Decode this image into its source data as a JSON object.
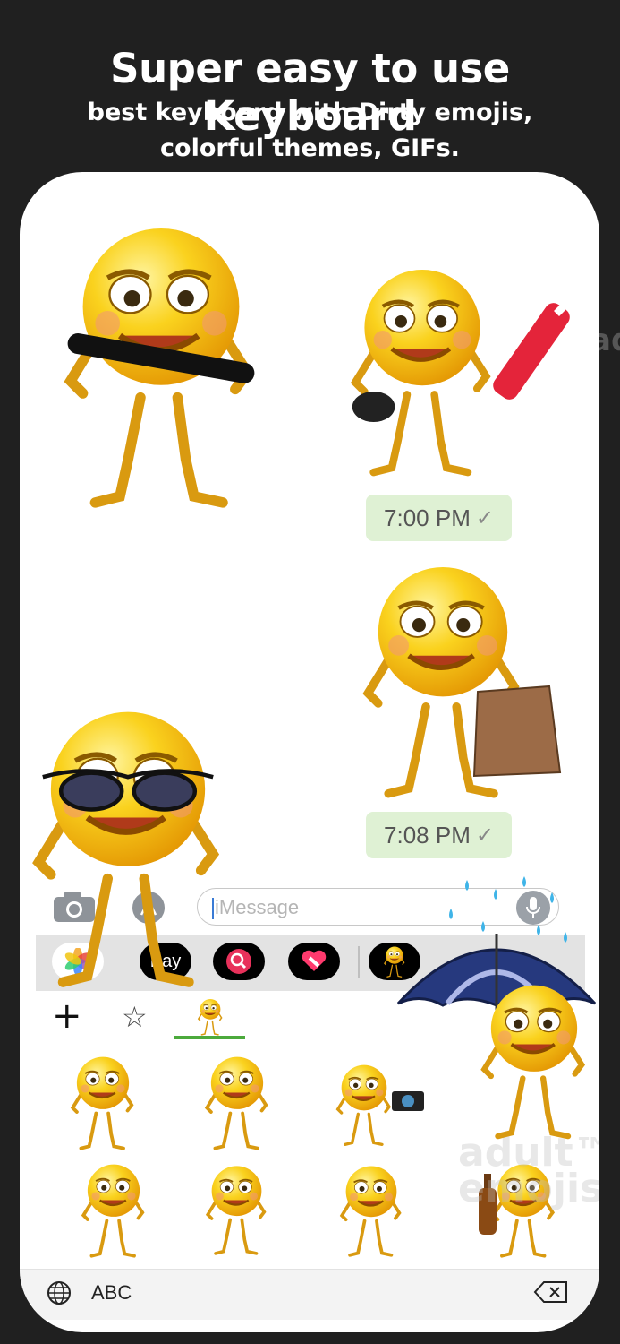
{
  "header": {
    "headline": "Super easy to use Keyboard",
    "subline1": "best keyboard with Dirty emojis,",
    "subline2": "colorful themes, GIFs."
  },
  "messages": [
    {
      "time": "7:00 PM",
      "status_icon": "checkmark-icon"
    },
    {
      "time": "7:08 PM",
      "status_icon": "checkmark-icon"
    }
  ],
  "compose": {
    "placeholder": "iMessage"
  },
  "app_strip": {
    "pay_label": "Pay",
    "items": [
      "photos-icon",
      "apple-pay",
      "search-web-icon",
      "heart-sticker-icon",
      "emoji-app-icon"
    ]
  },
  "keyboard": {
    "tabs": [
      "plus-icon",
      "star-icon",
      "emoji-pack-tab"
    ],
    "bottom_label": "ABC"
  },
  "watermark": {
    "line1": "adult™",
    "line2": "emojis"
  },
  "colors": {
    "background": "#202020",
    "phone": "#ffffff",
    "bubble": "#dff1d4",
    "accent_green": "#4caa3c",
    "emoji_yellow": "#f7c21b"
  }
}
